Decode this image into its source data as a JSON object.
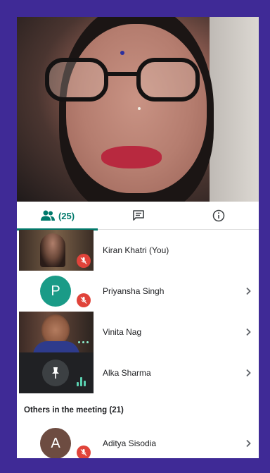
{
  "tabs": {
    "people_count": "(25)"
  },
  "participants": [
    {
      "name": "Kiran Khatri (You)",
      "muted": true,
      "kind": "video"
    },
    {
      "name": "Priyansha Singh",
      "muted": true,
      "kind": "avatar",
      "initial": "P",
      "avatar_color": "#1a9b87"
    },
    {
      "name": "Vinita Nag",
      "muted": false,
      "kind": "video"
    },
    {
      "name": "Alka Sharma",
      "muted": false,
      "kind": "pinned"
    }
  ],
  "others_section": {
    "label": "Others in the meeting (21)"
  },
  "others": [
    {
      "name": "Aditya Sisodia",
      "initial": "A",
      "avatar_color": "#6d4c41",
      "muted": true
    }
  ],
  "colors": {
    "frame_bg": "#3f2a96",
    "accent": "#00796b",
    "mute_red": "#e0433a"
  }
}
